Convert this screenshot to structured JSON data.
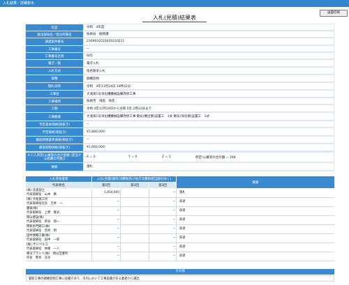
{
  "header": {
    "title": "入札結果／詳細表示",
    "print_label": "画面印刷"
  },
  "page_title": "入札(見積)結果表",
  "fields": [
    {
      "label": "年度",
      "value": "令和　4年度"
    },
    {
      "label": "発注部局名／発注所属名",
      "value": "技術局　総務課"
    },
    {
      "label": "調達案件番号",
      "value": "2309010520020220211"
    },
    {
      "label": "工事番号",
      "value": "−"
    },
    {
      "label": "工事番号名称",
      "value": "605"
    },
    {
      "label": "電子／紙",
      "value": "電子入札"
    },
    {
      "label": "入札方式",
      "value": "指名競争入札"
    },
    {
      "label": "業種",
      "value": "鋼構造物"
    },
    {
      "label": "開札日時",
      "value": "令和　4年11月24日 10時32分"
    },
    {
      "label": "工事名",
      "value": "大滝第1号浄化槽機械設備改修工事"
    },
    {
      "label": "工事場所",
      "value": "技術市　飛鳥　地先"
    },
    {
      "label": "工期",
      "value": "令和 4年11月24日から令和 5年 2月22日まで"
    },
    {
      "label": "工事概要",
      "value": "大滝第1号浄化槽機械設備改修工事 散気(機出側)設置工　1式 散気(浄化側)設置工　1式"
    },
    {
      "label": "予定基本価格(税抜き)",
      "value": "−"
    },
    {
      "label": "予定価格(税抜き)",
      "value": "¥1,880,000-"
    },
    {
      "label": "最低制限基準価格(税抜き)",
      "value": "−"
    },
    {
      "label": "最低制限価格(税抜き)",
      "value": "¥1,660,000-"
    }
  ],
  "score_row": {
    "label": "X,Y,Z,所定(公募等の合計金額 (該当する経費の内数))",
    "x": "X = 0",
    "y": "Y = 0",
    "z": "Z = 3",
    "note": "所定(公募等の合計額 = 398"
  },
  "remarks": {
    "label": "摘要",
    "value": "落札"
  },
  "bid_table": {
    "col_participants": "入札参加業者",
    "col_rep": "代表者名",
    "col_amounts": "入札(見積)額等(消費税及び地方消費税相当額を除く)",
    "col_round1": "第1回",
    "col_round2": "第2回",
    "col_round3": "第3回",
    "col_remarks": "摘要",
    "rows": [
      {
        "company": "(株) 北奥国土",
        "rep": "代表取締役　山本　勝",
        "r1": "1,850,000",
        "r2": "",
        "r3": "−",
        "remark": "落札"
      },
      {
        "company": "(株) 大松鉄工所",
        "rep": "代表取締役社長　吉井　一",
        "r1": "−",
        "r2": "",
        "r3": "−",
        "remark": "辞退"
      },
      {
        "company": "瀬翁(株)",
        "rep": "代表取締役　上野　隆史",
        "r1": "−",
        "r2": "",
        "r3": "−",
        "remark": "辞退"
      },
      {
        "company": "岡山建設(株)",
        "rep": "代表取締役　新谷　翔一",
        "r1": "−",
        "r2": "",
        "r3": "−",
        "remark": "辞退"
      },
      {
        "company": "明和水門鋼工(株)",
        "rep": "代表取締役　西村　明",
        "r1": "−",
        "r2": "",
        "r3": "−",
        "remark": "辞退"
      },
      {
        "company": "田中建機工業(株)",
        "rep": "代表取締役　田中　一郎",
        "r1": "−",
        "r2": "",
        "r3": "−",
        "remark": "辞退"
      },
      {
        "company": "(株) サンペルコ",
        "rep": "代表取締役　林尾　一人",
        "r1": "−",
        "r2": "",
        "r3": "−",
        "remark": "辞退"
      },
      {
        "company": "東洋プラント(株)　岡山営業所",
        "rep": "所長　勢見　浩幸",
        "r1": "−",
        "r2": "",
        "r3": "−",
        "remark": "辞退"
      }
    ]
  },
  "other": {
    "label": "その他",
    "value": "最新工事の鋼構造物工事に実績があり、市内において工事実績がある業者から選出"
  }
}
